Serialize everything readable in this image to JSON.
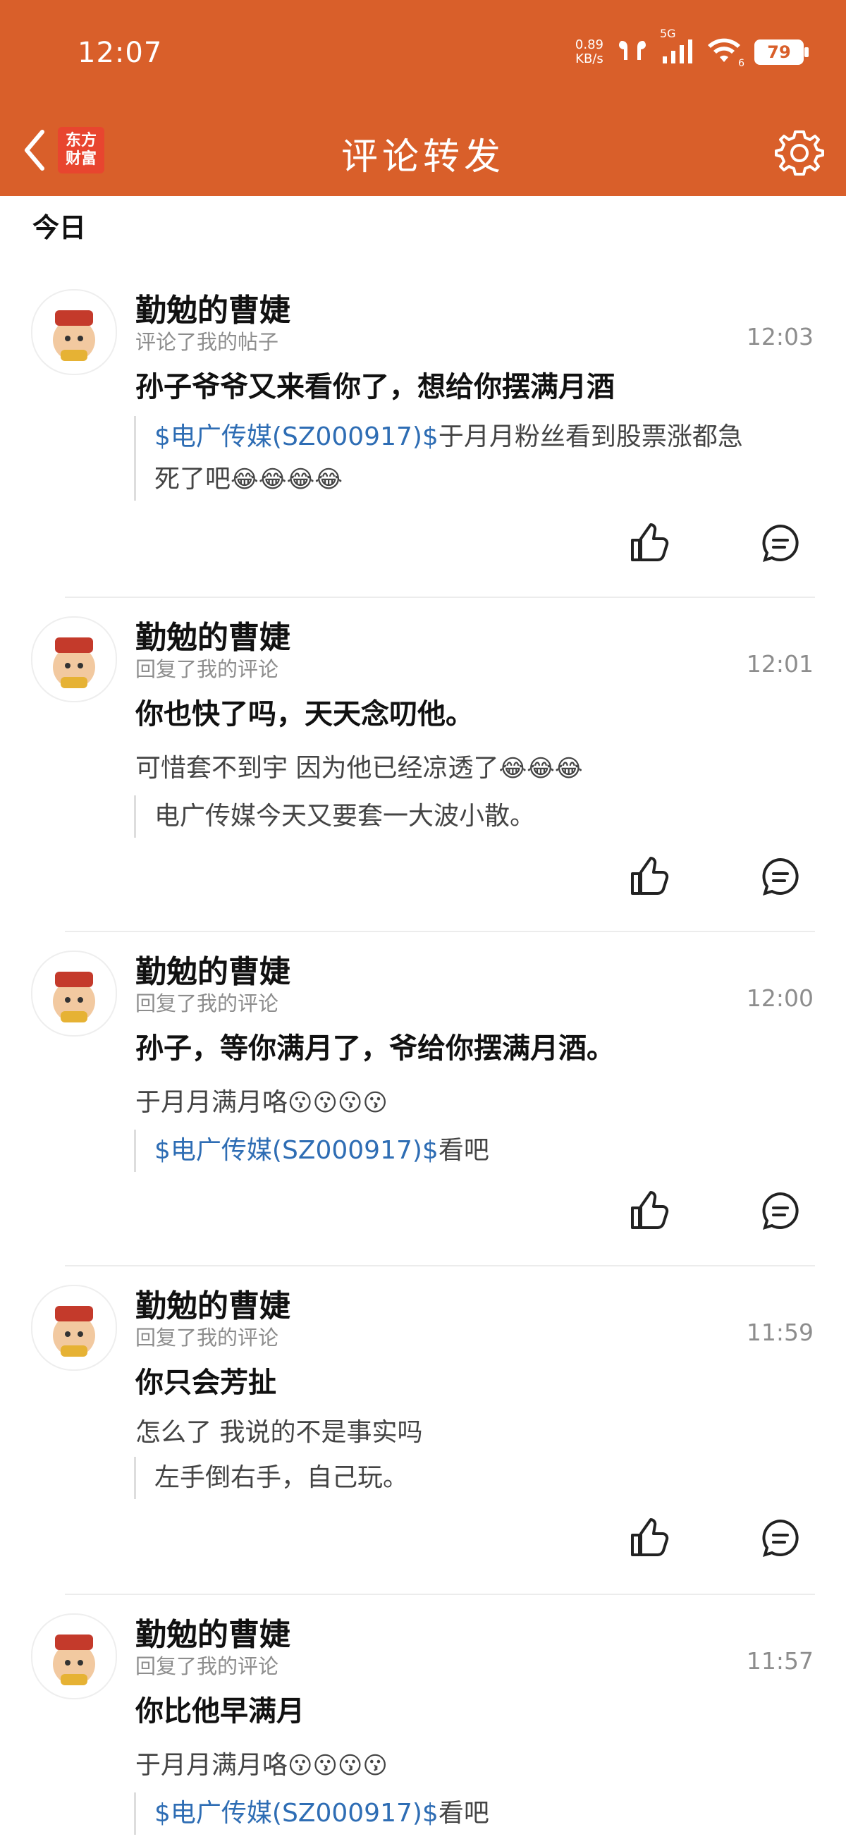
{
  "status_bar": {
    "time": "12:07",
    "net_speed_value": "0.89",
    "net_speed_unit": "KB/s",
    "network": "5G",
    "wifi_index": "6",
    "battery": "79"
  },
  "nav": {
    "title": "评论转发",
    "brand_line1": "东方",
    "brand_line2": "财富"
  },
  "section": {
    "today": "今日"
  },
  "comments": [
    {
      "name": "勤勉的曹婕",
      "action": "评论了我的帖子",
      "time": "12:03",
      "headline": "孙子爷爷又来看你了，想给你摆满月酒",
      "quote_stock": "$电广传媒(SZ000917)$",
      "quote_text_1": "于月月粉丝看到股票涨都急",
      "quote_text_2": "死了吧",
      "emojis": "😂😂😂😂"
    },
    {
      "name": "勤勉的曹婕",
      "action": "回复了我的评论",
      "time": "12:01",
      "headline": "你也快了吗，天天念叨他。",
      "body": "可惜套不到宇  因为他已经凉透了",
      "body_emojis": "😂😂😂",
      "quote": "电广传媒今天又要套一大波小散。"
    },
    {
      "name": "勤勉的曹婕",
      "action": "回复了我的评论",
      "time": "12:00",
      "headline": "孙子，等你满月了，爷给你摆满月酒。",
      "body": "于月月满月咯",
      "body_emojis": "😗😗😗😗",
      "quote_stock": "$电广传媒(SZ000917)$",
      "quote_text": "看吧"
    },
    {
      "name": "勤勉的曹婕",
      "action": "回复了我的评论",
      "time": "11:59",
      "headline": "你只会芳扯",
      "body": "怎么了  我说的不是事实吗",
      "quote": "左手倒右手，自己玩。"
    },
    {
      "name": "勤勉的曹婕",
      "action": "回复了我的评论",
      "time": "11:57",
      "headline": "你比他早满月",
      "body": "于月月满月咯",
      "body_emojis": "😗😗😗😗",
      "quote_stock": "$电广传媒(SZ000917)$",
      "quote_text": "看吧"
    }
  ],
  "colors": {
    "accent": "#D95F2A",
    "stock_link": "#2E6DB4",
    "muted": "#8d8d8d"
  },
  "icons": [
    "back-arrow-icon",
    "gear-icon",
    "thumbs-up-icon",
    "comment-icon",
    "wifi-icon",
    "signal-icon",
    "earbuds-icon"
  ]
}
